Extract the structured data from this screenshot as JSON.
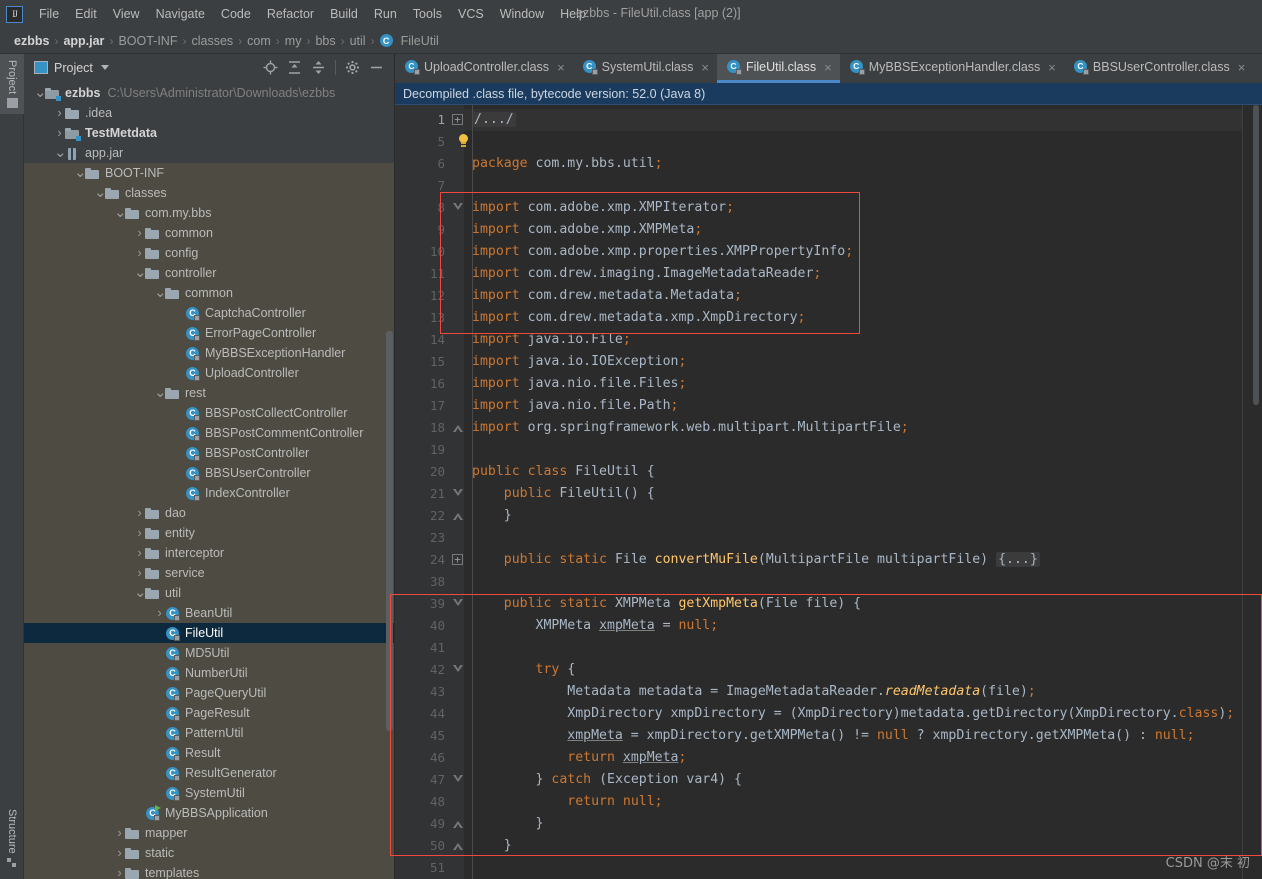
{
  "window": {
    "title": "ezbbs - FileUtil.class [app (2)]",
    "logo_label": "IJ"
  },
  "menubar": {
    "items": [
      {
        "label": "File"
      },
      {
        "label": "Edit"
      },
      {
        "label": "View"
      },
      {
        "label": "Navigate"
      },
      {
        "label": "Code"
      },
      {
        "label": "Refactor"
      },
      {
        "label": "Build"
      },
      {
        "label": "Run"
      },
      {
        "label": "Tools"
      },
      {
        "label": "VCS"
      },
      {
        "label": "Window"
      },
      {
        "label": "Help"
      }
    ]
  },
  "breadcrumb": {
    "items": [
      {
        "label": "ezbbs",
        "bold": true,
        "icon": null
      },
      {
        "label": "app.jar",
        "bold": true,
        "icon": null
      },
      {
        "label": "BOOT-INF",
        "bold": false,
        "icon": null
      },
      {
        "label": "classes",
        "bold": false,
        "icon": null
      },
      {
        "label": "com",
        "bold": false,
        "icon": null
      },
      {
        "label": "my",
        "bold": false,
        "icon": null
      },
      {
        "label": "bbs",
        "bold": false,
        "icon": null
      },
      {
        "label": "util",
        "bold": false,
        "icon": null
      },
      {
        "label": "FileUtil",
        "bold": false,
        "icon": "class-icon"
      }
    ],
    "separator": "›"
  },
  "left_strip": {
    "project_label": "Project",
    "structure_label": "Structure"
  },
  "project_panel": {
    "title": "Project",
    "tools": [
      "locate-icon",
      "expand-all-icon",
      "collapse-all-icon",
      "settings-icon",
      "minimize-icon"
    ],
    "tree": [
      {
        "depth": 0,
        "arrow": "∨",
        "icon": "folder-module",
        "label": "ezbbs",
        "bold": true,
        "path": "C:\\Users\\Administrator\\Downloads\\ezbbs",
        "state": "normal"
      },
      {
        "depth": 1,
        "arrow": "›",
        "icon": "folder",
        "label": ".idea",
        "bold": false,
        "path": "",
        "state": "normal"
      },
      {
        "depth": 1,
        "arrow": "›",
        "icon": "folder-module",
        "label": "TestMetdata",
        "bold": true,
        "path": "",
        "state": "normal"
      },
      {
        "depth": 1,
        "arrow": "∨",
        "icon": "jar",
        "label": "app.jar",
        "bold": false,
        "path": "",
        "state": "normal"
      },
      {
        "depth": 2,
        "arrow": "∨",
        "icon": "folder",
        "label": "BOOT-INF",
        "bold": false,
        "path": "",
        "state": "jar"
      },
      {
        "depth": 3,
        "arrow": "∨",
        "icon": "folder",
        "label": "classes",
        "bold": false,
        "path": "",
        "state": "jar"
      },
      {
        "depth": 4,
        "arrow": "∨",
        "icon": "folder",
        "label": "com.my.bbs",
        "bold": false,
        "path": "",
        "state": "jar"
      },
      {
        "depth": 5,
        "arrow": "›",
        "icon": "folder",
        "label": "common",
        "bold": false,
        "path": "",
        "state": "jar"
      },
      {
        "depth": 5,
        "arrow": "›",
        "icon": "folder",
        "label": "config",
        "bold": false,
        "path": "",
        "state": "jar"
      },
      {
        "depth": 5,
        "arrow": "∨",
        "icon": "folder",
        "label": "controller",
        "bold": false,
        "path": "",
        "state": "jar"
      },
      {
        "depth": 6,
        "arrow": "∨",
        "icon": "folder",
        "label": "common",
        "bold": false,
        "path": "",
        "state": "jar"
      },
      {
        "depth": 7,
        "arrow": "",
        "icon": "class",
        "label": "CaptchaController",
        "bold": false,
        "path": "",
        "state": "jar"
      },
      {
        "depth": 7,
        "arrow": "",
        "icon": "class",
        "label": "ErrorPageController",
        "bold": false,
        "path": "",
        "state": "jar"
      },
      {
        "depth": 7,
        "arrow": "",
        "icon": "class",
        "label": "MyBBSExceptionHandler",
        "bold": false,
        "path": "",
        "state": "jar"
      },
      {
        "depth": 7,
        "arrow": "",
        "icon": "class",
        "label": "UploadController",
        "bold": false,
        "path": "",
        "state": "jar"
      },
      {
        "depth": 6,
        "arrow": "∨",
        "icon": "folder",
        "label": "rest",
        "bold": false,
        "path": "",
        "state": "jar"
      },
      {
        "depth": 7,
        "arrow": "",
        "icon": "class",
        "label": "BBSPostCollectController",
        "bold": false,
        "path": "",
        "state": "jar"
      },
      {
        "depth": 7,
        "arrow": "",
        "icon": "class",
        "label": "BBSPostCommentController",
        "bold": false,
        "path": "",
        "state": "jar"
      },
      {
        "depth": 7,
        "arrow": "",
        "icon": "class",
        "label": "BBSPostController",
        "bold": false,
        "path": "",
        "state": "jar"
      },
      {
        "depth": 7,
        "arrow": "",
        "icon": "class",
        "label": "BBSUserController",
        "bold": false,
        "path": "",
        "state": "jar"
      },
      {
        "depth": 7,
        "arrow": "",
        "icon": "class",
        "label": "IndexController",
        "bold": false,
        "path": "",
        "state": "jar"
      },
      {
        "depth": 5,
        "arrow": "›",
        "icon": "folder",
        "label": "dao",
        "bold": false,
        "path": "",
        "state": "jar"
      },
      {
        "depth": 5,
        "arrow": "›",
        "icon": "folder",
        "label": "entity",
        "bold": false,
        "path": "",
        "state": "jar"
      },
      {
        "depth": 5,
        "arrow": "›",
        "icon": "folder",
        "label": "interceptor",
        "bold": false,
        "path": "",
        "state": "jar"
      },
      {
        "depth": 5,
        "arrow": "›",
        "icon": "folder",
        "label": "service",
        "bold": false,
        "path": "",
        "state": "jar"
      },
      {
        "depth": 5,
        "arrow": "∨",
        "icon": "folder",
        "label": "util",
        "bold": false,
        "path": "",
        "state": "jar"
      },
      {
        "depth": 6,
        "arrow": "›",
        "icon": "class",
        "label": "BeanUtil",
        "bold": false,
        "path": "",
        "state": "jar"
      },
      {
        "depth": 6,
        "arrow": "",
        "icon": "class",
        "label": "FileUtil",
        "bold": false,
        "path": "",
        "state": "selected"
      },
      {
        "depth": 6,
        "arrow": "",
        "icon": "class",
        "label": "MD5Util",
        "bold": false,
        "path": "",
        "state": "jar"
      },
      {
        "depth": 6,
        "arrow": "",
        "icon": "class",
        "label": "NumberUtil",
        "bold": false,
        "path": "",
        "state": "jar"
      },
      {
        "depth": 6,
        "arrow": "",
        "icon": "class",
        "label": "PageQueryUtil",
        "bold": false,
        "path": "",
        "state": "jar"
      },
      {
        "depth": 6,
        "arrow": "",
        "icon": "class",
        "label": "PageResult",
        "bold": false,
        "path": "",
        "state": "jar"
      },
      {
        "depth": 6,
        "arrow": "",
        "icon": "class",
        "label": "PatternUtil",
        "bold": false,
        "path": "",
        "state": "jar"
      },
      {
        "depth": 6,
        "arrow": "",
        "icon": "class",
        "label": "Result",
        "bold": false,
        "path": "",
        "state": "jar"
      },
      {
        "depth": 6,
        "arrow": "",
        "icon": "class",
        "label": "ResultGenerator",
        "bold": false,
        "path": "",
        "state": "jar"
      },
      {
        "depth": 6,
        "arrow": "",
        "icon": "class",
        "label": "SystemUtil",
        "bold": false,
        "path": "",
        "state": "jar"
      },
      {
        "depth": 5,
        "arrow": "",
        "icon": "class-run",
        "label": "MyBBSApplication",
        "bold": false,
        "path": "",
        "state": "jar"
      },
      {
        "depth": 4,
        "arrow": "›",
        "icon": "folder",
        "label": "mapper",
        "bold": false,
        "path": "",
        "state": "jar"
      },
      {
        "depth": 4,
        "arrow": "›",
        "icon": "folder",
        "label": "static",
        "bold": false,
        "path": "",
        "state": "jar"
      },
      {
        "depth": 4,
        "arrow": "›",
        "icon": "folder",
        "label": "templates",
        "bold": false,
        "path": "",
        "state": "jar"
      }
    ]
  },
  "editor": {
    "tabs": [
      {
        "label": "UploadController.class",
        "active": false,
        "close": "×"
      },
      {
        "label": "SystemUtil.class",
        "active": false,
        "close": "×"
      },
      {
        "label": "FileUtil.class",
        "active": true,
        "close": "×"
      },
      {
        "label": "MyBBSExceptionHandler.class",
        "active": false,
        "close": "×"
      },
      {
        "label": "BBSUserController.class",
        "active": false,
        "close": "×"
      }
    ],
    "notice": "Decompiled .class file, bytecode version: 52.0 (Java 8)",
    "lines": [
      {
        "num": "1",
        "fold": "plus",
        "html": "<span class=\"fold-ph\">/...&#47;</span>",
        "hl": true
      },
      {
        "num": "5",
        "fold": "bulb",
        "html": "",
        "hl": false
      },
      {
        "num": "6",
        "fold": "",
        "html": "<span class=\"kw\">package</span> <span class=\"pln\">com.my.bbs.util</span><span class=\"kw\">;</span>",
        "hl": false
      },
      {
        "num": "7",
        "fold": "",
        "html": "",
        "hl": false
      },
      {
        "num": "8",
        "fold": "open",
        "html": "<span class=\"kw\">import</span> <span class=\"pln\">com.adobe.xmp.XMPIterator</span><span class=\"kw\">;</span>",
        "hl": false
      },
      {
        "num": "9",
        "fold": "",
        "html": "<span class=\"kw\">import</span> <span class=\"pln\">com.adobe.xmp.XMPMeta</span><span class=\"kw\">;</span>",
        "hl": false
      },
      {
        "num": "10",
        "fold": "",
        "html": "<span class=\"kw\">import</span> <span class=\"pln\">com.adobe.xmp.properties.XMPPropertyInfo</span><span class=\"kw\">;</span>",
        "hl": false
      },
      {
        "num": "11",
        "fold": "",
        "html": "<span class=\"kw\">import</span> <span class=\"pln\">com.drew.imaging.ImageMetadataReader</span><span class=\"kw\">;</span>",
        "hl": false
      },
      {
        "num": "12",
        "fold": "",
        "html": "<span class=\"kw\">import</span> <span class=\"pln\">com.drew.metadata.Metadata</span><span class=\"kw\">;</span>",
        "hl": false
      },
      {
        "num": "13",
        "fold": "",
        "html": "<span class=\"kw\">import</span> <span class=\"pln\">com.drew.metadata.xmp.XmpDirectory</span><span class=\"kw\">;</span>",
        "hl": false
      },
      {
        "num": "14",
        "fold": "",
        "html": "<span class=\"kw\">import</span> <span class=\"pln\">java.io.File</span><span class=\"kw\">;</span>",
        "hl": false
      },
      {
        "num": "15",
        "fold": "",
        "html": "<span class=\"kw\">import</span> <span class=\"pln\">java.io.IOException</span><span class=\"kw\">;</span>",
        "hl": false
      },
      {
        "num": "16",
        "fold": "",
        "html": "<span class=\"kw\">import</span> <span class=\"pln\">java.nio.file.Files</span><span class=\"kw\">;</span>",
        "hl": false
      },
      {
        "num": "17",
        "fold": "",
        "html": "<span class=\"kw\">import</span> <span class=\"pln\">java.nio.file.Path</span><span class=\"kw\">;</span>",
        "hl": false
      },
      {
        "num": "18",
        "fold": "close",
        "html": "<span class=\"kw\">import</span> <span class=\"pln\">org.springframework.web.multipart.MultipartFile</span><span class=\"kw\">;</span>",
        "hl": false
      },
      {
        "num": "19",
        "fold": "",
        "html": "",
        "hl": false
      },
      {
        "num": "20",
        "fold": "",
        "html": "<span class=\"kw\">public class</span> <span class=\"pln\">FileUtil {</span>",
        "hl": false
      },
      {
        "num": "21",
        "fold": "open",
        "html": "    <span class=\"kw\">public</span> <span class=\"pln\">FileUtil() {</span>",
        "hl": false
      },
      {
        "num": "22",
        "fold": "close",
        "html": "    <span class=\"pln\">}</span>",
        "hl": false
      },
      {
        "num": "23",
        "fold": "",
        "html": "",
        "hl": false
      },
      {
        "num": "24",
        "fold": "plus",
        "html": "    <span class=\"kw\">public static</span> <span class=\"pln\">File</span> <span class=\"fn\">convertMuFile</span><span class=\"pln\">(MultipartFile multipartFile)</span> <span class=\"fold-ph\">{...}</span>",
        "hl": false
      },
      {
        "num": "38",
        "fold": "",
        "html": "",
        "hl": false
      },
      {
        "num": "39",
        "fold": "open",
        "html": "    <span class=\"kw\">public static</span> <span class=\"pln\">XMPMeta</span> <span class=\"fn\">getXmpMeta</span><span class=\"pln\">(File file) {</span>",
        "hl": false
      },
      {
        "num": "40",
        "fold": "",
        "html": "        <span class=\"pln\">XMPMeta </span><span class=\"underln\">xmpMeta</span><span class=\"pln\"> = </span><span class=\"kw\">null</span><span class=\"kw\">;</span>",
        "hl": false
      },
      {
        "num": "41",
        "fold": "",
        "html": "",
        "hl": false
      },
      {
        "num": "42",
        "fold": "open",
        "html": "        <span class=\"kw\">try</span> <span class=\"pln\">{</span>",
        "hl": false
      },
      {
        "num": "43",
        "fold": "",
        "html": "            <span class=\"pln\">Metadata metadata = ImageMetadataReader.</span><span class=\"fni\">readMetadata</span><span class=\"pln\">(file)</span><span class=\"kw\">;</span>",
        "hl": false
      },
      {
        "num": "44",
        "fold": "",
        "html": "            <span class=\"pln\">XmpDirectory xmpDirectory = (XmpDirectory)metadata.getDirectory(XmpDirectory.</span><span class=\"kw\">class</span><span class=\"pln\">)</span><span class=\"kw\">;</span>",
        "hl": false
      },
      {
        "num": "45",
        "fold": "",
        "html": "            <span class=\"underln\">xmpMeta</span><span class=\"pln\"> = xmpDirectory.getXMPMeta() != </span><span class=\"kw\">null</span><span class=\"pln\"> ? xmpDirectory.getXMPMeta() : </span><span class=\"kw\">null</span><span class=\"kw\">;</span>",
        "hl": false
      },
      {
        "num": "46",
        "fold": "",
        "html": "            <span class=\"kw\">return</span> <span class=\"underln\">xmpMeta</span><span class=\"kw\">;</span>",
        "hl": false
      },
      {
        "num": "47",
        "fold": "open",
        "html": "        <span class=\"pln\">} </span><span class=\"kw\">catch</span> <span class=\"pln\">(Exception var4) {</span>",
        "hl": false
      },
      {
        "num": "48",
        "fold": "",
        "html": "            <span class=\"kw\">return</span> <span class=\"kw\">null</span><span class=\"kw\">;</span>",
        "hl": false
      },
      {
        "num": "49",
        "fold": "close",
        "html": "        <span class=\"pln\">}</span>",
        "hl": false
      },
      {
        "num": "50",
        "fold": "close",
        "html": "    <span class=\"pln\">}</span>",
        "hl": false
      },
      {
        "num": "51",
        "fold": "",
        "html": "",
        "hl": false
      }
    ]
  },
  "annotations": {
    "imports_box_label": "imports-highlight-box",
    "method_box_label": "getxmpmeta-highlight-box"
  },
  "watermark": "CSDN @末 初",
  "colors": {
    "accent": "#4a88c7",
    "annotation": "#f04a3f",
    "editor_bg": "#2b2b2b",
    "panel_bg": "#3c3f41",
    "selection": "#0d293e",
    "keyword": "#cc7832",
    "method": "#ffc66d",
    "text": "#a9b7c6",
    "jar_zone": "#4e4b42"
  }
}
